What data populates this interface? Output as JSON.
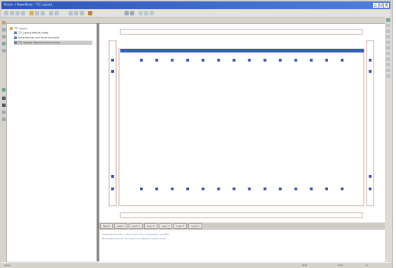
{
  "window": {
    "title": "Trends - [PowerPanel - TTC Layout]",
    "buttons": [
      "_",
      "□",
      "×"
    ]
  },
  "toolbar": {
    "buttons": [
      "new",
      "open",
      "save",
      "print",
      "cut",
      "copy",
      "paste",
      "undo",
      "redo",
      "zoom-in",
      "zoom-out",
      "fit",
      "run"
    ]
  },
  "tree": {
    "root": "TTC Layout",
    "items": [
      "TTC Layout default config",
      "Node address and Route info table",
      "TTC general Network system route"
    ]
  },
  "tabs": [
    "Page 1",
    "Layer 1",
    "Layer 2",
    "Layer 3",
    "Layer 4",
    "Layer 5",
    "Layer 6"
  ],
  "console": {
    "lines": [
      "Loading project file ... done. Layout TTC configuration complete",
      "Route table parsing: 24 nodes found. Network system ready."
    ]
  },
  "status": {
    "left": "Ready",
    "right": [
      "NUM",
      "100%",
      "1:1"
    ]
  },
  "colors": {
    "accent": "#2d58b8",
    "bus": "#2f5fb5",
    "node": "#3a55a8",
    "outline": "#c9a89e"
  },
  "layout_nodes": {
    "count_per_row": 14
  }
}
